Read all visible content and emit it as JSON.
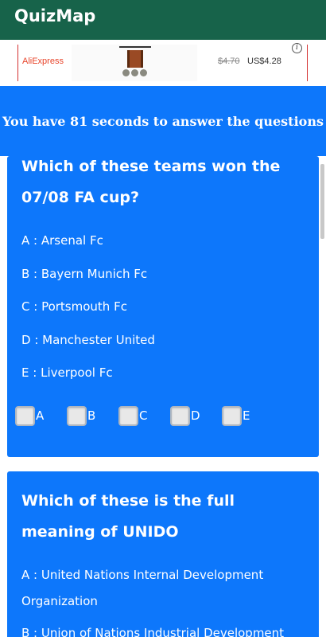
{
  "appbar": {
    "title": "QuizMap"
  },
  "ad": {
    "brand": "AliExpress",
    "old_price": "$4.70",
    "new_price": "US$4.28",
    "info_icon": "i"
  },
  "timer": {
    "text": "You have 81 seconds to answer the questions"
  },
  "questions": [
    {
      "question": "Which of these teams won the 07/08 FA cup?",
      "options": [
        {
          "key": "A :",
          "text": " Arsenal Fc"
        },
        {
          "key": "B :",
          "text": " Bayern Munich Fc"
        },
        {
          "key": "C :",
          "text": " Portsmouth Fc"
        },
        {
          "key": "D :",
          "text": " Manchester United"
        },
        {
          "key": "E :",
          "text": " Liverpool Fc"
        }
      ],
      "checkboxes": [
        "A",
        "B",
        "C",
        "D",
        "E"
      ]
    },
    {
      "question": "Which of these is the full meaning of UNIDO",
      "options": [
        {
          "key": "A :",
          "text": " United Nations Internal Development Organization"
        },
        {
          "key": "B :",
          "text": " Union of Nations Industrial Development"
        }
      ]
    }
  ],
  "colors": {
    "appbar": "#17634a",
    "primary": "#0d77fb"
  }
}
